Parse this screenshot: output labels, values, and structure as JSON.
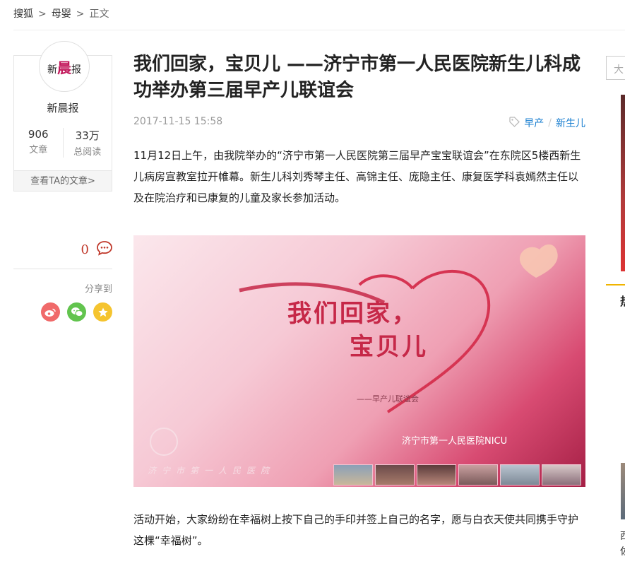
{
  "breadcrumb": {
    "home": "搜狐",
    "channel": "母婴",
    "current": "正文",
    "separator": ">"
  },
  "author": {
    "logo_left": "新",
    "logo_mid": "晨",
    "logo_right": "报",
    "name": "新晨报",
    "articles_value": "906",
    "articles_label": "文章",
    "reads_value": "33万",
    "reads_label": "总阅读",
    "more_link": "查看TA的文章>"
  },
  "actions": {
    "comment_count": "0",
    "share_label": "分享到",
    "share_icons": [
      "weibo-icon",
      "wechat-icon",
      "qzone-icon"
    ]
  },
  "article": {
    "title": "我们回家，宝贝儿 ——济宁市第一人民医院新生儿科成功举办第三届早产儿联谊会",
    "date": "2017-11-15 15:58",
    "tags": [
      "早产",
      "新生儿"
    ],
    "paragraph1": "11月12日上午，由我院举办的“济宁市第一人民医院第三届早产宝宝联谊会”在东院区5楼西新生儿病房宣教室拉开帷幕。新生儿科刘秀琴主任、高锦主任、庞隐主任、康复医学科袁嫣然主任以及在院治疗和已康复的儿童及家长参加活动。",
    "paragraph2": "活动开始，大家纷纷在幸福树上按下自己的手印并签上自己的名字，愿与白衣天使共同携手守护这棵“幸福树”。"
  },
  "hero": {
    "title_line1": "我们回家，",
    "title_line2": "宝贝儿",
    "subtitle": "——早产儿联谊会",
    "hospital": "济宁市第一人民医院NICU",
    "strip_text": "济宁市第一人民医院"
  },
  "rail": {
    "search_placeholder": "大",
    "section_char": "热",
    "text_line1": "西",
    "text_line2": "佐"
  },
  "colors": {
    "accent_red": "#c0392b",
    "link_blue": "#1a7fd0",
    "brand_pink": "#c2185b"
  }
}
